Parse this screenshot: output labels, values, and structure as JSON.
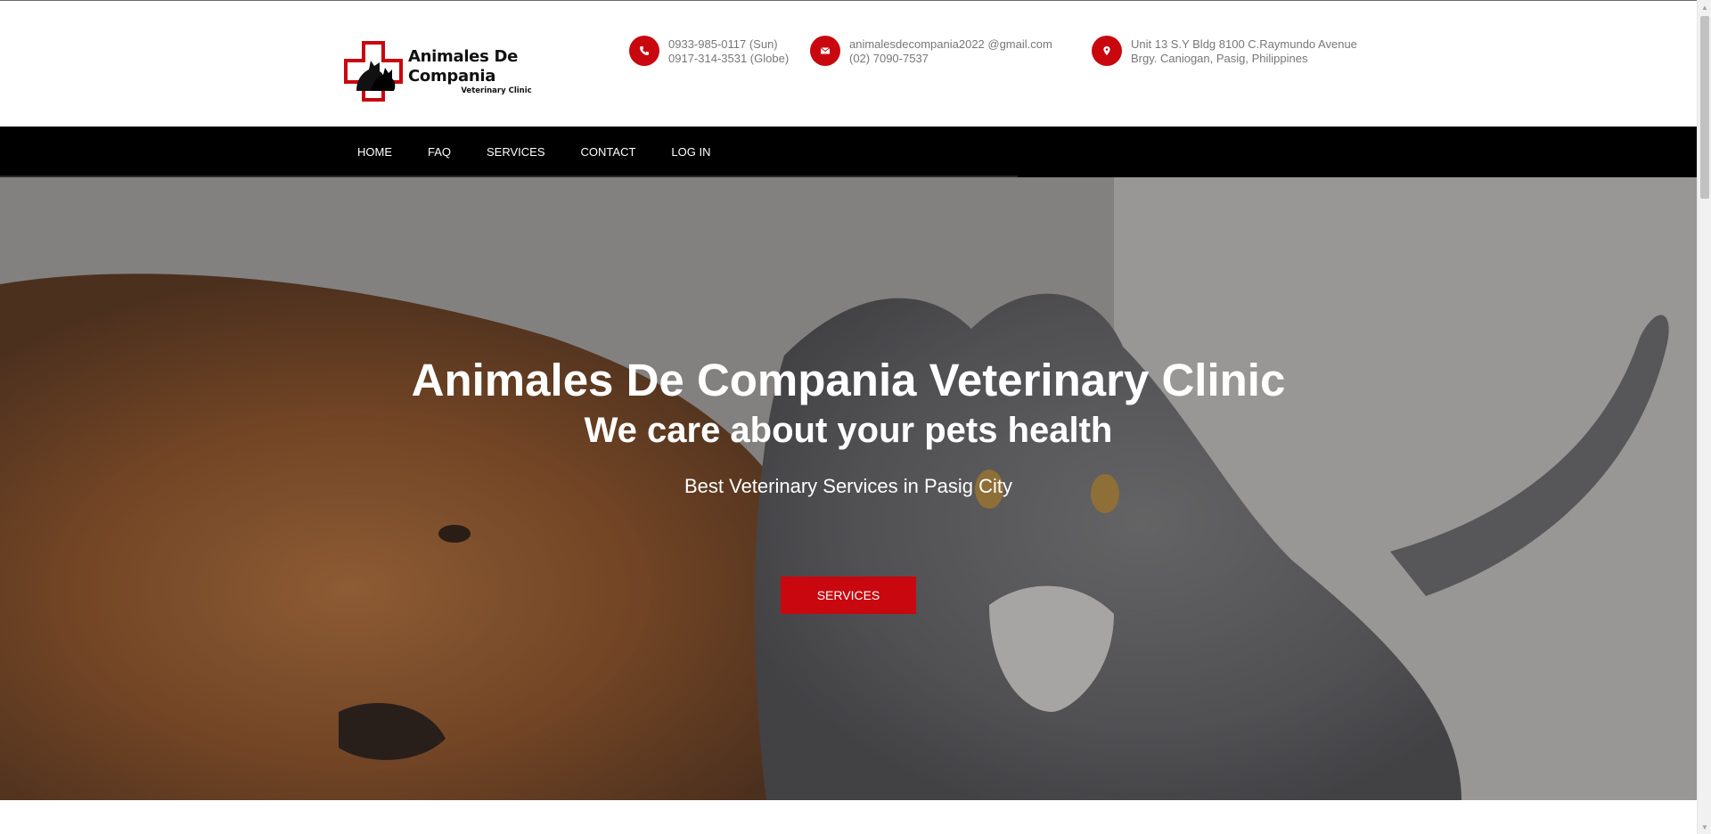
{
  "brand": {
    "name": "Animales De Compania",
    "subtitle": "Veterinary Clinic",
    "accent_color": "#c8070f"
  },
  "contacts": {
    "phone": {
      "icon": "phone-icon",
      "line1": "0933-985-0117 (Sun)",
      "line2": "0917-314-3531 (Globe)"
    },
    "email": {
      "icon": "envelope-icon",
      "line1": "animalesdecompania2022 @gmail.com",
      "line2": "(02) 7090-7537"
    },
    "address": {
      "icon": "map-pin-icon",
      "line1": "Unit 13 S.Y Bldg 8100 C.Raymundo Avenue",
      "line2": "Brgy. Caniogan, Pasig, Philippines"
    }
  },
  "nav": {
    "items": [
      {
        "label": "HOME"
      },
      {
        "label": "FAQ"
      },
      {
        "label": "SERVICES"
      },
      {
        "label": "CONTACT"
      },
      {
        "label": "LOG IN"
      }
    ]
  },
  "hero": {
    "title": "Animales De Compania Veterinary Clinic",
    "tagline": "We care about your pets health",
    "subtitle": "Best Veterinary Services in Pasig City",
    "button_label": "SERVICES"
  }
}
